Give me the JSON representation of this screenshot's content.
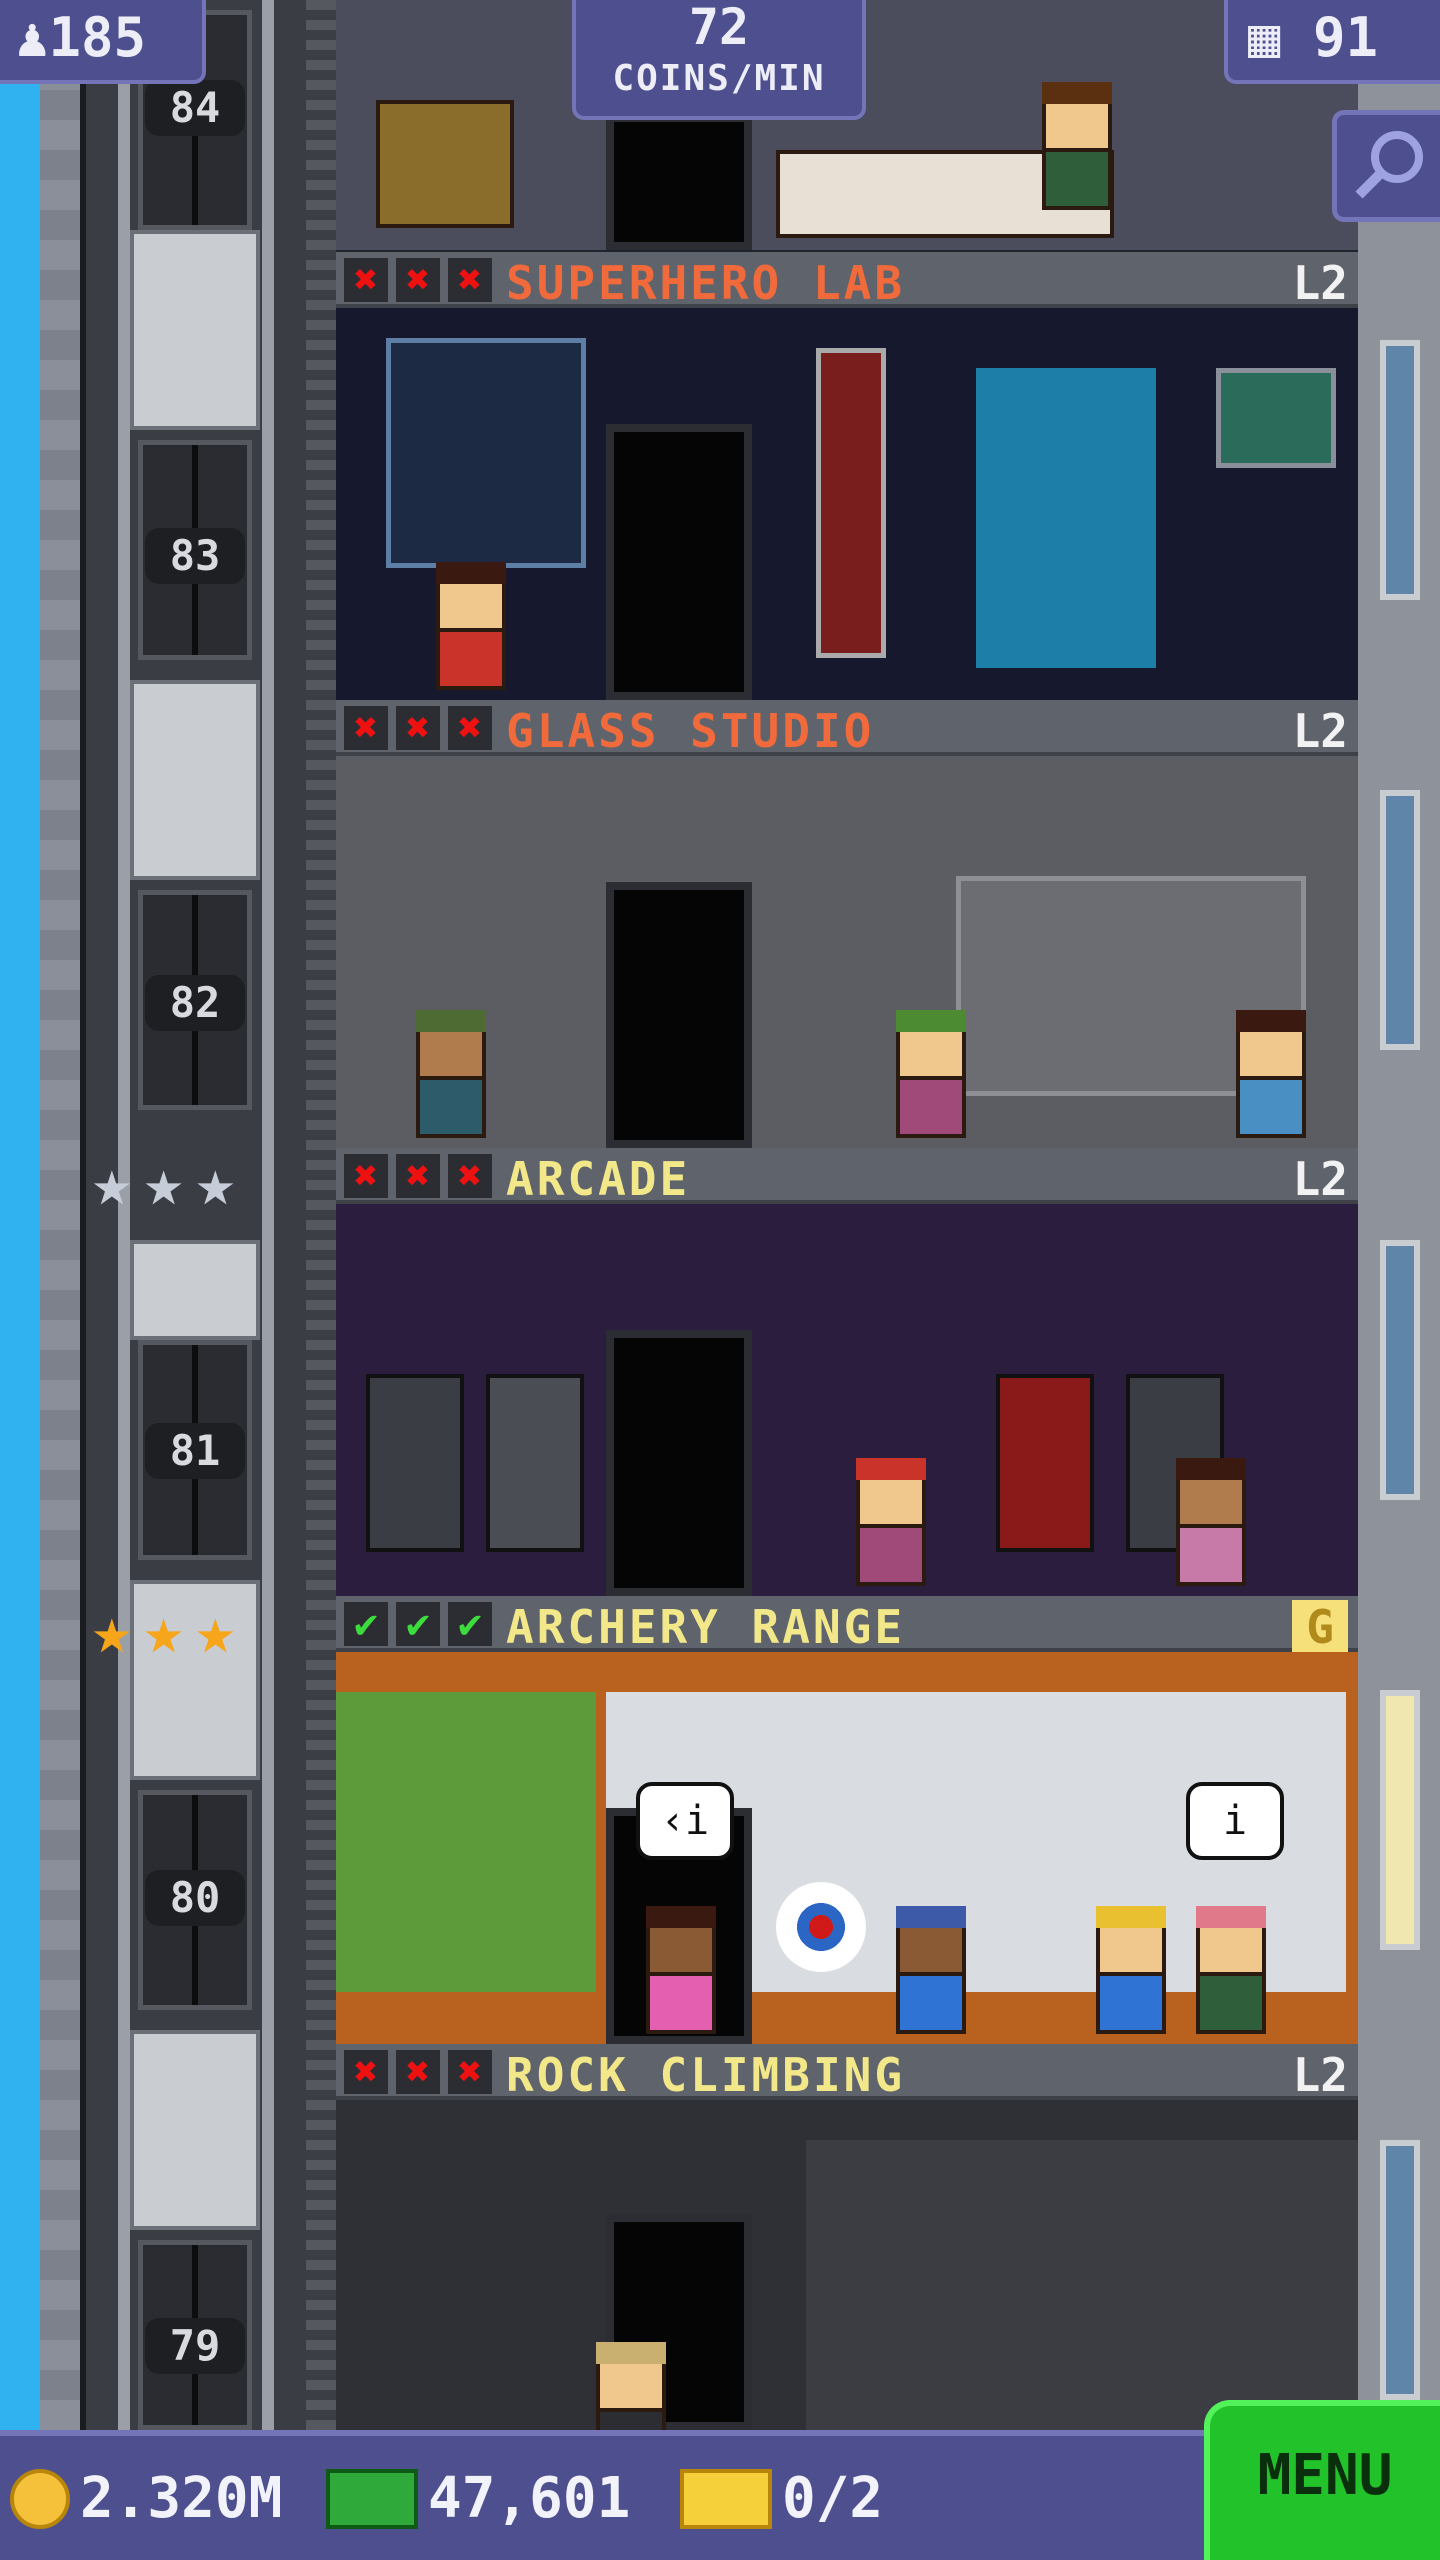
{
  "hud": {
    "population": "185",
    "coins_rate": "72",
    "coins_rate_unit": "COINS/MIN",
    "floors": "91"
  },
  "elevator": {
    "floor_numbers": [
      "84",
      "83",
      "82",
      "81",
      "80",
      "79"
    ]
  },
  "floors": [
    {
      "name": "SUPERHERO LAB",
      "level": "L2",
      "name_color": "#f06a3c",
      "stocked": false
    },
    {
      "name": "GLASS STUDIO",
      "level": "L2",
      "name_color": "#f06a3c",
      "stocked": false
    },
    {
      "name": "ARCADE",
      "level": "L2",
      "name_color": "#f2e88a",
      "stocked": false
    },
    {
      "name": "ARCHERY RANGE",
      "level": "G",
      "name_color": "#f2e88a",
      "stocked": true
    },
    {
      "name": "ROCK CLIMBING",
      "level": "L2",
      "name_color": "#f2e88a",
      "stocked": false
    }
  ],
  "speech": {
    "bubble1": "‹i",
    "bubble2": "i"
  },
  "bottom": {
    "coins": "2.320M",
    "bux": "47,601",
    "tickets": "0/2",
    "menu_label": "MENU"
  },
  "colors": {
    "hud_bg": "#4d4f8e",
    "menu_green": "#22c32a",
    "sky": "#2fb2ef",
    "red_mark": "#e11111",
    "green_mark": "#3ddc3d",
    "gold_star": "#f7a51a",
    "silver_star": "#c6ccd8"
  }
}
